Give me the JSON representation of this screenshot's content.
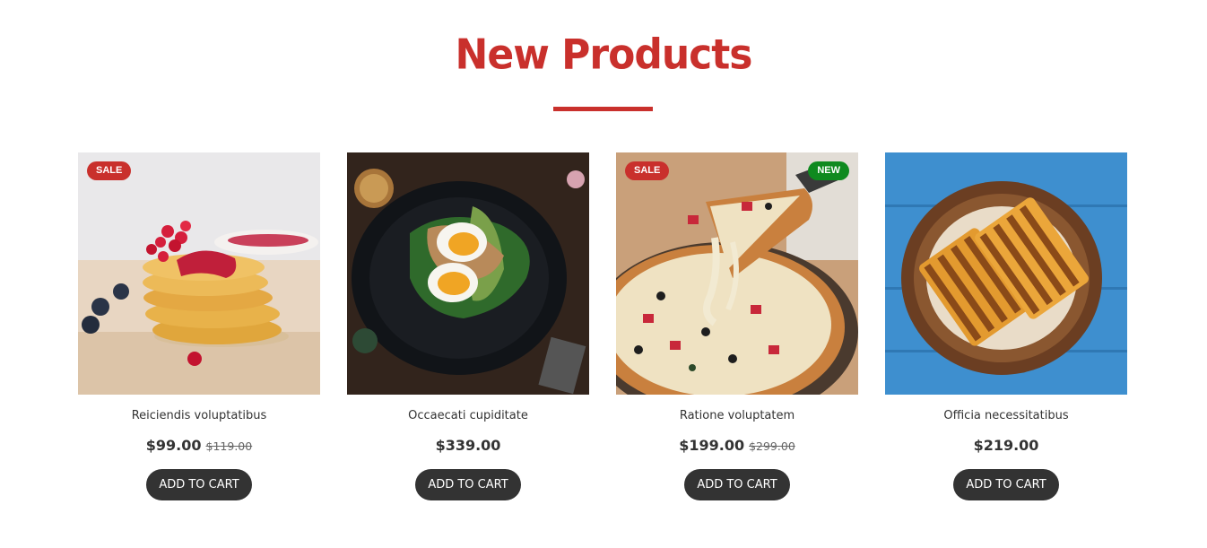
{
  "section": {
    "title": "New Products"
  },
  "colors": {
    "accent": "#c9302c",
    "new_badge": "#0f8a1f",
    "button": "#333333"
  },
  "products": [
    {
      "name": "Reiciendis voluptatibus",
      "price": "$99.00",
      "old_price": "$119.00",
      "badge_sale": "SALE",
      "badge_new": "",
      "image": "pancakes-with-berries",
      "button": "ADD TO CART"
    },
    {
      "name": "Occaecati cupiditate",
      "price": "$339.00",
      "old_price": "",
      "badge_sale": "",
      "badge_new": "",
      "image": "egg-avocado-plate",
      "button": "ADD TO CART"
    },
    {
      "name": "Ratione voluptatem",
      "price": "$199.00",
      "old_price": "$299.00",
      "badge_sale": "SALE",
      "badge_new": "NEW",
      "image": "pizza-slice",
      "button": "ADD TO CART"
    },
    {
      "name": "Officia necessitatibus",
      "price": "$219.00",
      "old_price": "",
      "badge_sale": "",
      "badge_new": "",
      "image": "grilled-sandwich",
      "button": "ADD TO CART"
    }
  ]
}
